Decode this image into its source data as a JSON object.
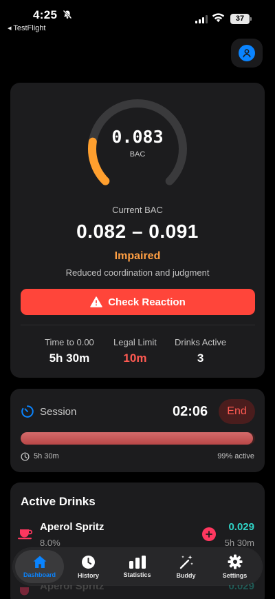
{
  "status_bar": {
    "time": "4:25",
    "back_app": "◂ TestFlight",
    "battery": "37"
  },
  "gauge": {
    "value": "0.083",
    "label": "BAC",
    "fill_fraction": 0.2,
    "color": "#ff9f2e"
  },
  "bac": {
    "current_label": "Current BAC",
    "range": "0.082 – 0.091",
    "state": "Impaired",
    "state_description": "Reduced coordination and judgment"
  },
  "check_button": {
    "label": "Check Reaction"
  },
  "stats": [
    {
      "label": "Time to 0.00",
      "value": "5h 30m"
    },
    {
      "label": "Legal Limit",
      "value": "10m"
    },
    {
      "label": "Drinks Active",
      "value": "3"
    }
  ],
  "session": {
    "title": "Session",
    "elapsed": "02:06",
    "end_label": "End",
    "progress_percent": 99,
    "remaining": "5h 30m",
    "active_label": "99% active"
  },
  "active_drinks": {
    "title": "Active Drinks",
    "items": [
      {
        "name": "Aperol Spritz",
        "abv": "8.0%",
        "bac": "0.029",
        "time": "5h 30m"
      },
      {
        "name": "Aperol Spritz",
        "bac": "0.029"
      }
    ]
  },
  "tabs": [
    {
      "label": "Dashboard",
      "icon": "house-icon",
      "active": true
    },
    {
      "label": "History",
      "icon": "clock-icon",
      "active": false
    },
    {
      "label": "Statistics",
      "icon": "chart-bars-icon",
      "active": false
    },
    {
      "label": "Buddy",
      "icon": "magic-wand-icon",
      "active": false
    },
    {
      "label": "Settings",
      "icon": "gear-icon",
      "active": false
    }
  ],
  "colors": {
    "accent": "#0a84ff",
    "warning": "#ff9f43",
    "danger": "#ff453a",
    "teal": "#30d5c8"
  }
}
